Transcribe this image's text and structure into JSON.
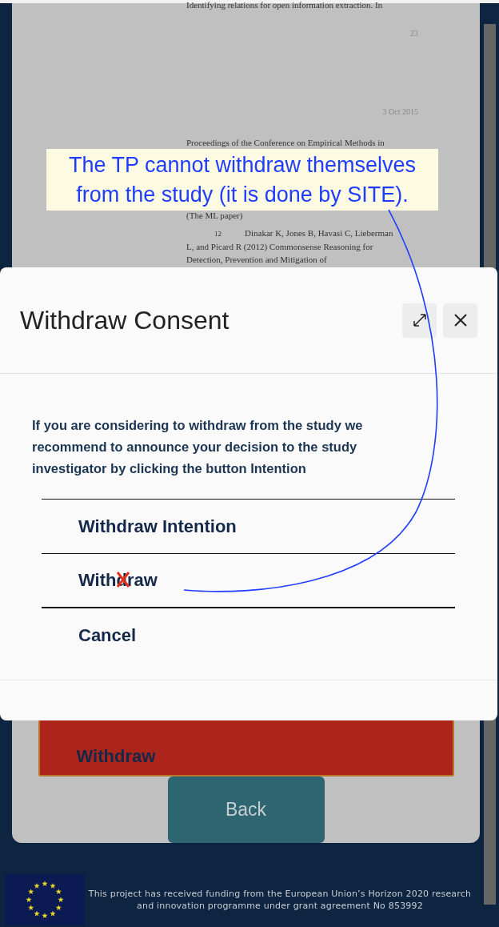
{
  "document": {
    "lines": [
      {
        "kind": "text",
        "text": "Identifying relations for open information extraction. In"
      },
      {
        "kind": "page-number",
        "text": "23"
      },
      {
        "kind": "date",
        "text": "3 Oct 2015"
      },
      {
        "kind": "text",
        "text": "Proceedings of the Conference on Empirical Methods in"
      },
      {
        "kind": "hidden"
      },
      {
        "kind": "text",
        "text": "(The ML paper)"
      },
      {
        "kind": "reference",
        "number": "12",
        "text": "Dinakar K,   Jones B,   Havasi C,   Lieberman"
      },
      {
        "kind": "text",
        "text": "L, and   Picard R (2012) Commonsense Reasoning for"
      },
      {
        "kind": "text",
        "text": "Detection, Prevention and Mitigation of"
      }
    ]
  },
  "page_buttons": [
    {
      "kind": "danger",
      "label": "Withdraw"
    },
    {
      "kind": "back",
      "label": "Back"
    }
  ],
  "footer": {
    "text": "This project has received funding from the European Union’s Horizon 2020 research and innovation programme under grant agreement No 853992"
  },
  "modal": {
    "title": "Withdraw Consent",
    "message": "If you are considering to withdraw from the study we recommend to announce your decision to the study investigator by clicking the button Intention",
    "options": [
      {
        "label": "Withdraw Intention",
        "crossed": false
      },
      {
        "label": "Withdraw",
        "crossed": true
      },
      {
        "label": "Cancel",
        "crossed": false
      }
    ]
  },
  "annotation": {
    "text": "The TP cannot withdraw themselves from the study (it is done by SITE)."
  }
}
